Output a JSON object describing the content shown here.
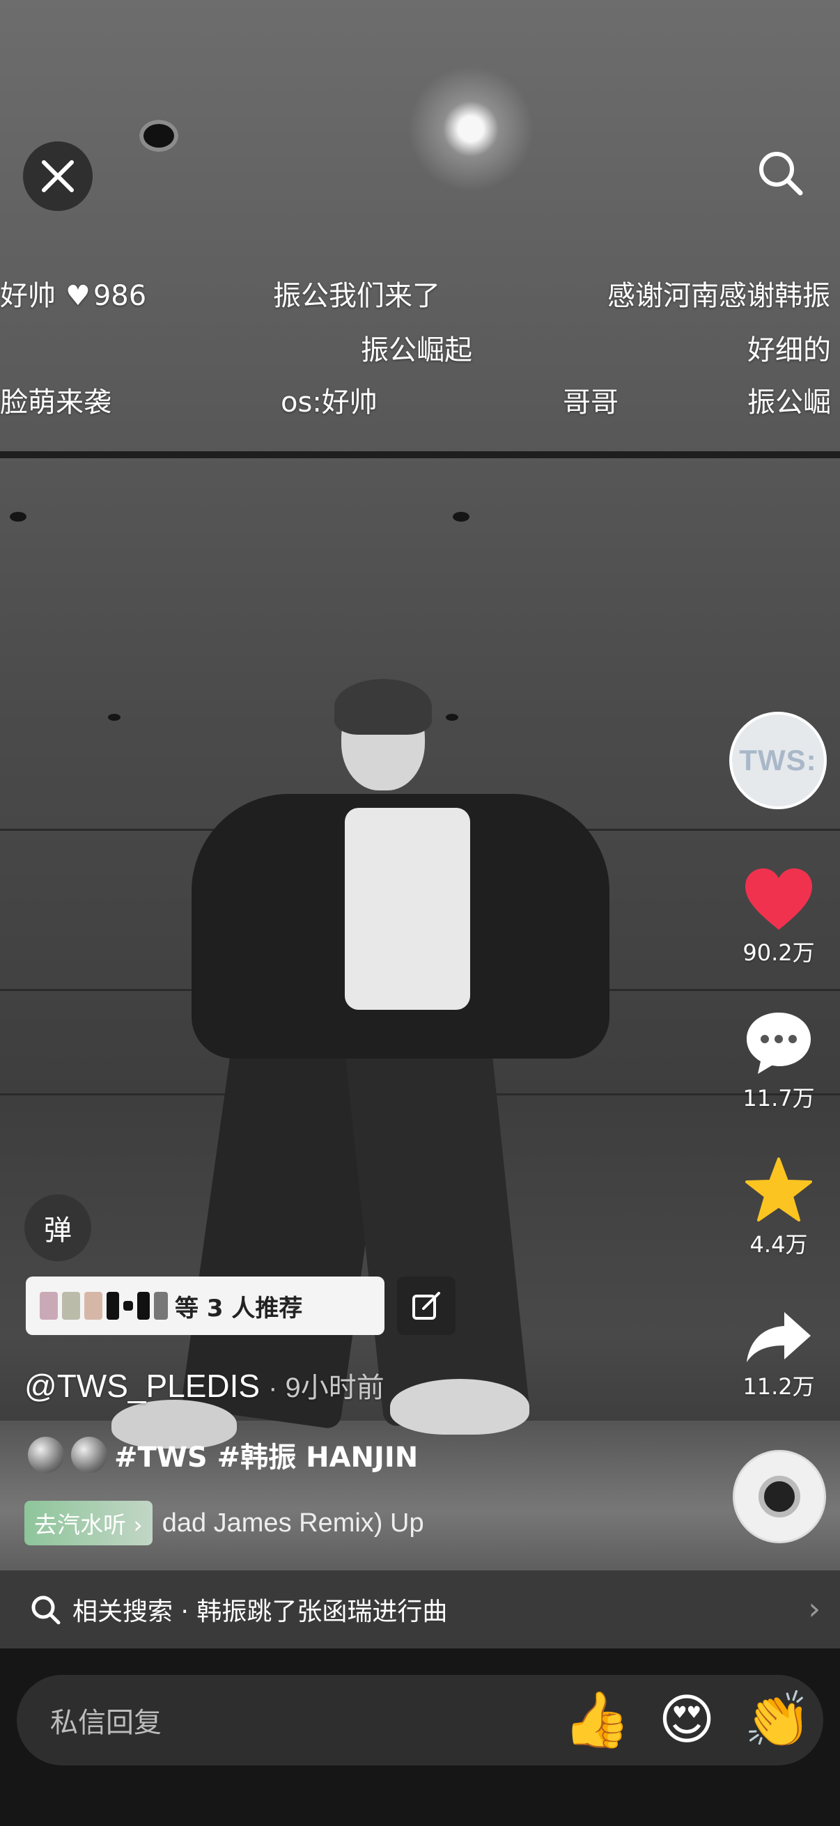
{
  "video": {
    "danmaku": [
      {
        "text": "好帅",
        "likes": "986"
      },
      {
        "text": "振公我们来了"
      },
      {
        "text": "感谢河南感谢韩振"
      },
      {
        "text": "振公崛起"
      },
      {
        "text": "好细的"
      },
      {
        "text": "脸萌来袭"
      },
      {
        "text": "os:好帅"
      },
      {
        "text": "哥哥"
      },
      {
        "text": "振公崛"
      }
    ]
  },
  "sidebar": {
    "avatar_text": "TWS:",
    "likes": "90.2万",
    "comments": "11.7万",
    "favorites": "4.4万",
    "shares": "11.2万"
  },
  "overlay": {
    "danmu_toggle": "弹",
    "recommend": "等 3 人推荐",
    "author": "@TWS_PLEDIS",
    "time": "· 9小时前",
    "caption": "#TWS #韩振 HANJIN",
    "music_tag": "去汽水听 ›",
    "music_title": "dad James Remix)   Up"
  },
  "related": {
    "label": "相关搜索 · 韩振跳了张函瑞进行曲"
  },
  "reply": {
    "placeholder": "私信回复"
  },
  "colors": {
    "like": "#f0324f",
    "favorite": "#fcc421"
  }
}
